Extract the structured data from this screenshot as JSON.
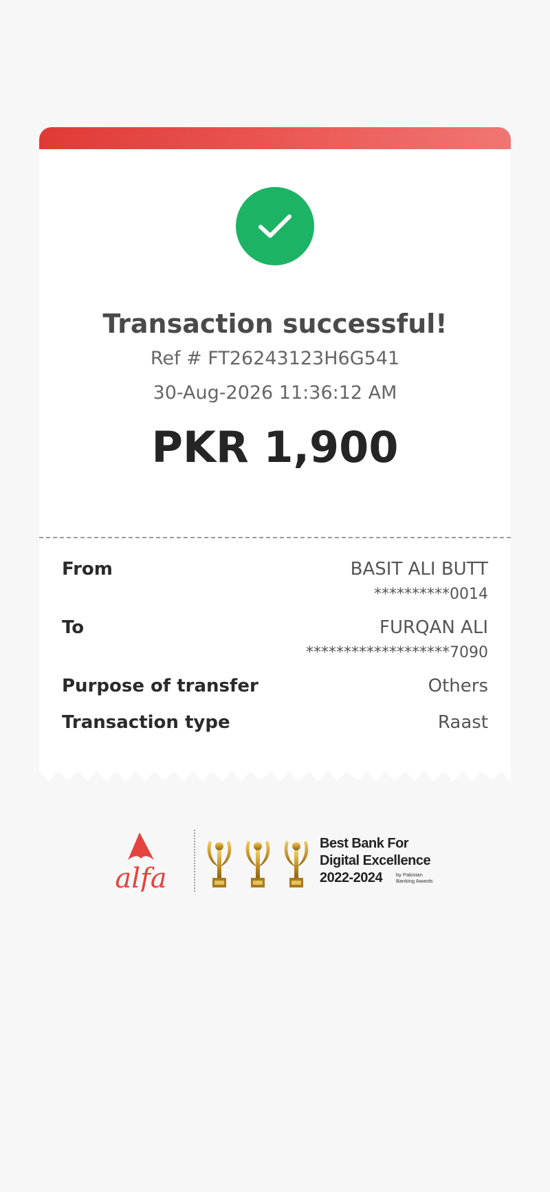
{
  "status": {
    "title": "Transaction successful!",
    "reference": "Ref # FT26243123H6G541",
    "datetime": "30-Aug-2026 11:36:12 AM",
    "amount": "PKR 1,900",
    "icon": "check-circle-icon",
    "accent_color": "#1db364"
  },
  "details": {
    "from": {
      "label": "From",
      "name": "BASIT ALI BUTT",
      "account": "**********0014"
    },
    "to": {
      "label": "To",
      "name": "FURQAN ALI",
      "account": "*******************7090"
    },
    "purpose": {
      "label": "Purpose of transfer",
      "value": "Others"
    },
    "type": {
      "label": "Transaction type",
      "value": "Raast"
    }
  },
  "footer": {
    "logo_text": "alfa",
    "award_line1": "Best Bank For",
    "award_line2": "Digital Excellence",
    "award_line3": "2022-2024",
    "award_by": "by Pakistan Banking Awards",
    "brand_color": "#e5433f"
  }
}
